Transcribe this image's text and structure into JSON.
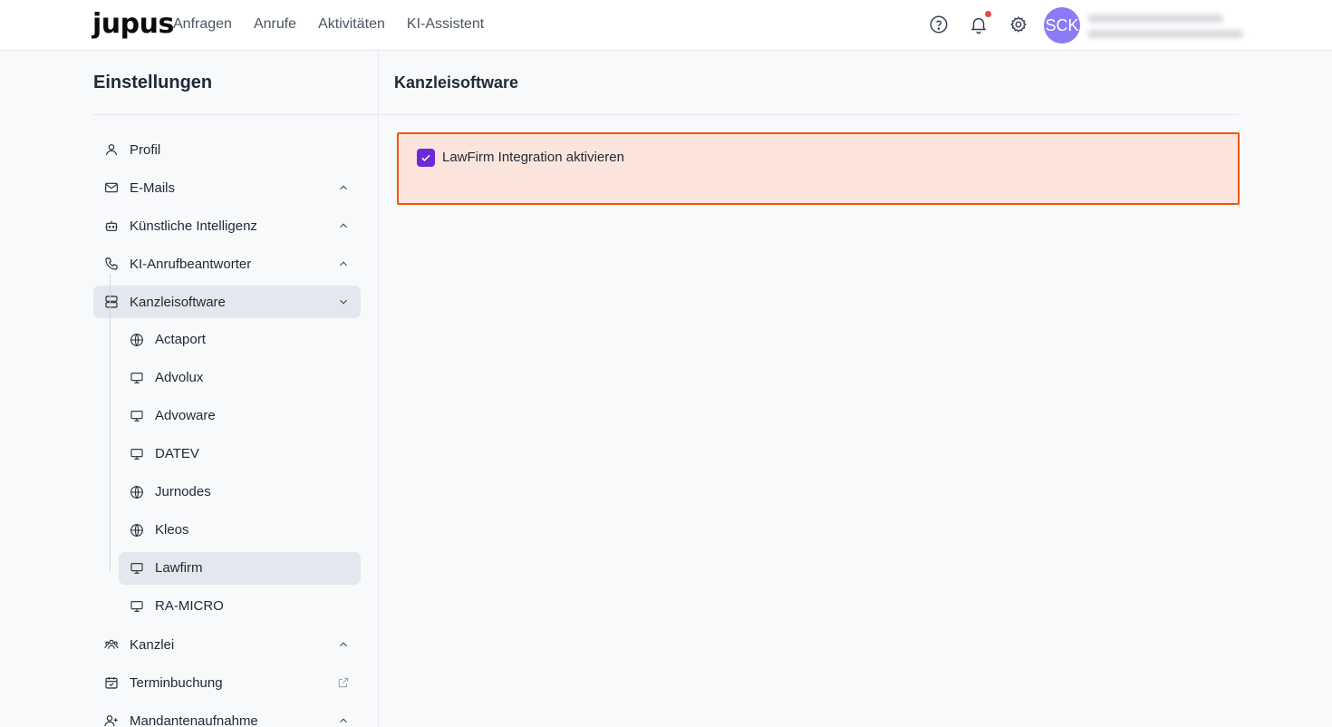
{
  "header": {
    "logo": "jupus",
    "nav": [
      "Anfragen",
      "Anrufe",
      "Aktivitäten",
      "KI-Assistent"
    ],
    "icons": [
      "help-circle-icon",
      "bell-icon",
      "gear-icon"
    ],
    "avatar_initials": "SCK"
  },
  "sidebar": {
    "title": "Einstellungen",
    "items": [
      {
        "label": "Profil",
        "icon": "user-icon",
        "chevron": ""
      },
      {
        "label": "E-Mails",
        "icon": "mail-icon",
        "chevron": "up"
      },
      {
        "label": "Künstliche Intelligenz",
        "icon": "bot-icon",
        "chevron": "up"
      },
      {
        "label": "KI-Anrufbeantworter",
        "icon": "phone-icon",
        "chevron": "up"
      },
      {
        "label": "Kanzleisoftware",
        "icon": "server-icon",
        "chevron": "down",
        "active": true
      },
      {
        "label": "Kanzlei",
        "icon": "users-icon",
        "chevron": "up"
      },
      {
        "label": "Terminbuchung",
        "icon": "calendar-check-icon",
        "chevron": "external"
      },
      {
        "label": "Mandantenaufnahme",
        "icon": "user-plus-icon",
        "chevron": "up"
      }
    ],
    "subitems": [
      {
        "label": "Actaport",
        "icon": "globe-icon"
      },
      {
        "label": "Advolux",
        "icon": "monitor-icon"
      },
      {
        "label": "Advoware",
        "icon": "monitor-icon"
      },
      {
        "label": "DATEV",
        "icon": "monitor-icon"
      },
      {
        "label": "Jurnodes",
        "icon": "globe-icon"
      },
      {
        "label": "Kleos",
        "icon": "globe-icon"
      },
      {
        "label": "Lawfirm",
        "icon": "monitor-icon",
        "active": true
      },
      {
        "label": "RA-MICRO",
        "icon": "monitor-icon"
      }
    ]
  },
  "main": {
    "title": "Kanzleisoftware",
    "checkbox_label": "LawFirm Integration aktivieren",
    "checkbox_checked": true
  },
  "colors": {
    "accent": "#6d28d9",
    "highlight_border": "#ea580c",
    "highlight_bg": "#fbe4dc",
    "avatar_bg": "#8b7cf6",
    "notification": "#ef4444"
  }
}
